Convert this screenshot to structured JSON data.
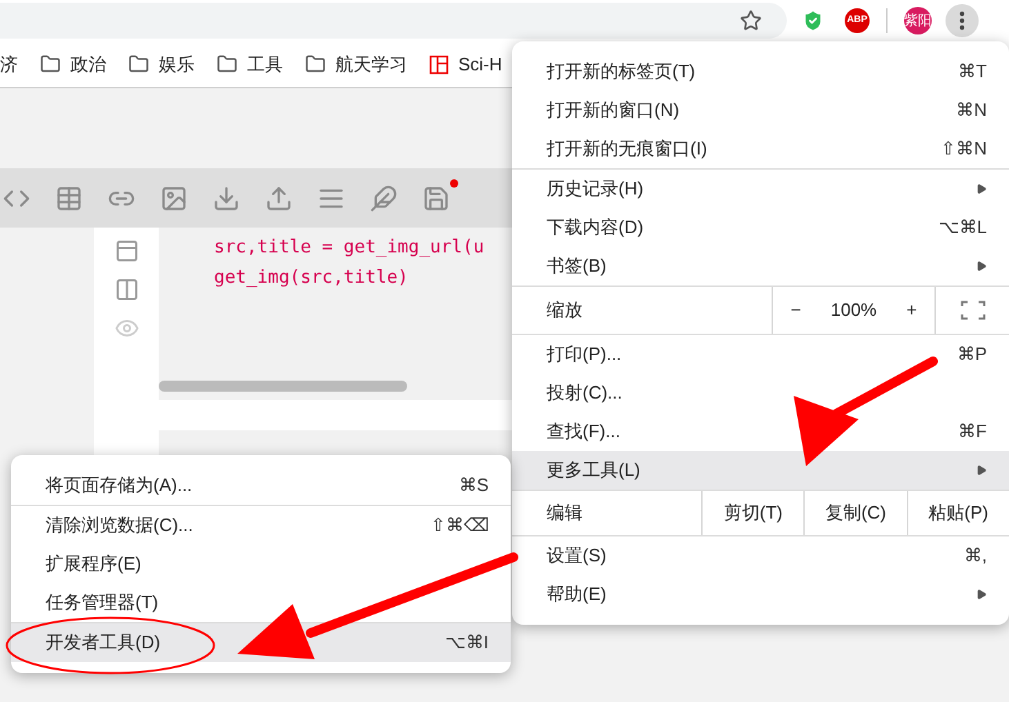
{
  "browser": {
    "adblock_text": "ABP",
    "avatar_text": "紫阳"
  },
  "bookmarks": [
    {
      "kind": "folder",
      "label": "济"
    },
    {
      "kind": "folder",
      "label": "政治"
    },
    {
      "kind": "folder",
      "label": "娱乐"
    },
    {
      "kind": "folder",
      "label": "工具"
    },
    {
      "kind": "folder",
      "label": "航天学习"
    },
    {
      "kind": "site",
      "label": "Sci-H"
    }
  ],
  "editor": {
    "code_lines": [
      "src,title = get_img_url(u",
      "get_img(src,title)"
    ]
  },
  "main_menu": {
    "sections": [
      [
        {
          "kind": "item",
          "label": "打开新的标签页(T)",
          "shortcut": "⌘T",
          "submenu": false,
          "selected": false
        },
        {
          "kind": "item",
          "label": "打开新的窗口(N)",
          "shortcut": "⌘N",
          "submenu": false,
          "selected": false
        },
        {
          "kind": "item",
          "label": "打开新的无痕窗口(I)",
          "shortcut": "⇧⌘N",
          "submenu": false,
          "selected": false
        }
      ],
      [
        {
          "kind": "item",
          "label": "历史记录(H)",
          "submenu": true,
          "selected": false
        },
        {
          "kind": "item",
          "label": "下载内容(D)",
          "shortcut": "⌥⌘L",
          "submenu": false,
          "selected": false
        },
        {
          "kind": "item",
          "label": "书签(B)",
          "submenu": true,
          "selected": false
        }
      ],
      [
        {
          "kind": "zoom",
          "label": "缩放",
          "minus": "−",
          "value": "100%",
          "plus": "+"
        }
      ],
      [
        {
          "kind": "item",
          "label": "打印(P)...",
          "shortcut": "⌘P",
          "submenu": false,
          "selected": false
        },
        {
          "kind": "item",
          "label": "投射(C)...",
          "submenu": false,
          "selected": false
        },
        {
          "kind": "item",
          "label": "查找(F)...",
          "shortcut": "⌘F",
          "submenu": false,
          "selected": false
        },
        {
          "kind": "item",
          "label": "更多工具(L)",
          "submenu": true,
          "selected": true
        }
      ],
      [
        {
          "kind": "edit",
          "label": "编辑",
          "buttons": [
            "剪切(T)",
            "复制(C)",
            "粘贴(P)"
          ]
        }
      ],
      [
        {
          "kind": "item",
          "label": "设置(S)",
          "shortcut": "⌘,",
          "submenu": false,
          "selected": false
        },
        {
          "kind": "item",
          "label": "帮助(E)",
          "submenu": true,
          "selected": false
        }
      ]
    ]
  },
  "sub_menu": {
    "sections": [
      [
        {
          "kind": "item",
          "label": "将页面存储为(A)...",
          "shortcut": "⌘S",
          "submenu": false,
          "selected": false
        }
      ],
      [
        {
          "kind": "item",
          "label": "清除浏览数据(C)...",
          "shortcut": "⇧⌘⌫",
          "submenu": false,
          "selected": false
        },
        {
          "kind": "item",
          "label": "扩展程序(E)",
          "submenu": false,
          "selected": false
        },
        {
          "kind": "item",
          "label": "任务管理器(T)",
          "submenu": false,
          "selected": false
        }
      ],
      [
        {
          "kind": "item",
          "label": "开发者工具(D)",
          "shortcut": "⌥⌘I",
          "submenu": false,
          "selected": true
        }
      ]
    ]
  }
}
